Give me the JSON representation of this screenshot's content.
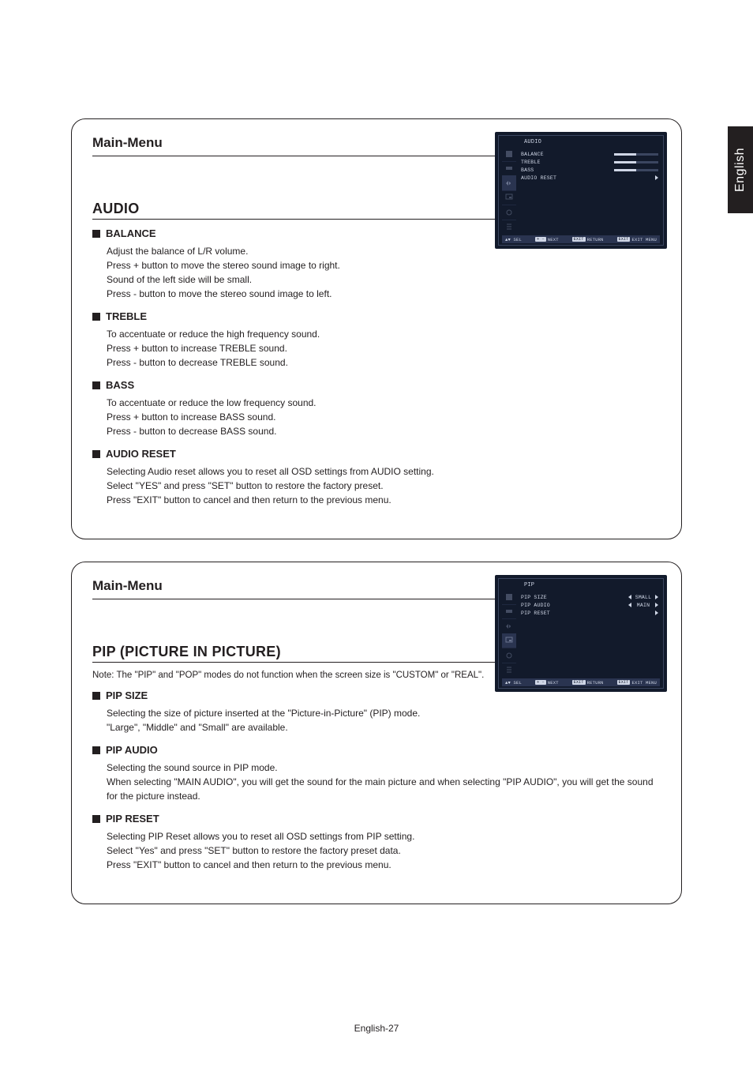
{
  "language_tab": "English",
  "page_number": "English-27",
  "cards": [
    {
      "main_menu": "Main-Menu",
      "section_title": "AUDIO",
      "note": "",
      "osd": {
        "title": "AUDIO",
        "active_icon": 2,
        "rows": [
          {
            "label": "BALANCE",
            "type": "bar"
          },
          {
            "label": "TREBLE",
            "type": "bar"
          },
          {
            "label": "BASS",
            "type": "bar"
          },
          {
            "label": "AUDIO RESET",
            "type": "arrow"
          }
        ],
        "footer": {
          "sel": "SEL",
          "next": "NEXT",
          "return": "RETURN",
          "exit": "EXIT MENU"
        }
      },
      "items": [
        {
          "head": "BALANCE",
          "body": "Adjust the balance of L/R volume.\nPress + button to move the stereo sound image to right.\nSound of the left side will be small.\nPress - button to move the stereo sound image to left."
        },
        {
          "head": "TREBLE",
          "body": "To accentuate or reduce the high frequency sound.\nPress + button to increase TREBLE sound.\nPress - button to decrease TREBLE sound."
        },
        {
          "head": "BASS",
          "body": "To accentuate or reduce the low frequency sound.\nPress + button to increase BASS sound.\nPress - button to decrease BASS sound."
        },
        {
          "head": "AUDIO RESET",
          "body": "Selecting Audio reset allows you to reset all OSD settings from AUDIO setting.\nSelect \"YES\" and press \"SET\" button to restore the factory preset.\nPress \"EXIT\" button to cancel and then return to the previous menu."
        }
      ]
    },
    {
      "main_menu": "Main-Menu",
      "section_title": "PIP (PICTURE IN PICTURE)",
      "note": "Note: The \"PIP\" and \"POP\" modes do not function when the screen size is \"CUSTOM\" or \"REAL\".",
      "osd": {
        "title": "PIP",
        "active_icon": 3,
        "rows": [
          {
            "label": "PIP SIZE",
            "type": "select",
            "value": "SMALL"
          },
          {
            "label": "PIP AUDIO",
            "type": "select",
            "value": "MAIN"
          },
          {
            "label": "PIP RESET",
            "type": "arrow"
          }
        ],
        "footer": {
          "sel": "SEL",
          "next": "NEXT",
          "return": "RETURN",
          "exit": "EXIT MENU"
        }
      },
      "items": [
        {
          "head": "PIP SIZE",
          "body": "Selecting the size of picture inserted at the \"Picture-in-Picture\" (PIP) mode.\n\"Large\", \"Middle\" and \"Small\" are available."
        },
        {
          "head": "PIP AUDIO",
          "body": "Selecting the sound source in PIP mode.\nWhen selecting \"MAIN AUDIO\", you will get the sound for the main picture and when selecting \"PIP AUDIO\", you will get the sound for the picture instead."
        },
        {
          "head": "PIP RESET",
          "body": "Selecting PIP Reset allows you to reset all OSD settings from PIP setting.\nSelect \"Yes\" and press \"SET\" button to restore the factory preset data.\nPress \"EXIT\" button to cancel and then return to the previous menu."
        }
      ]
    }
  ]
}
